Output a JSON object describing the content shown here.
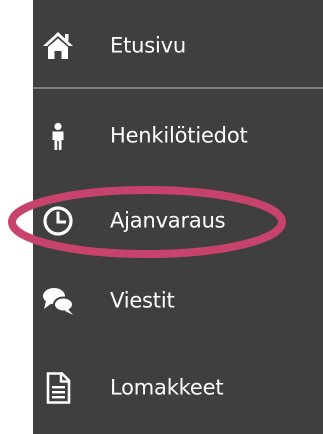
{
  "accent_color": "#c8436b",
  "menu": {
    "items": [
      {
        "label": "Etusivu",
        "icon": "home-icon"
      },
      {
        "label": "Henkilötiedot",
        "icon": "person-icon"
      },
      {
        "label": "Ajanvaraus",
        "icon": "clock-icon"
      },
      {
        "label": "Viestit",
        "icon": "chat-bubbles-icon"
      },
      {
        "label": "Lomakkeet",
        "icon": "document-icon"
      }
    ]
  }
}
